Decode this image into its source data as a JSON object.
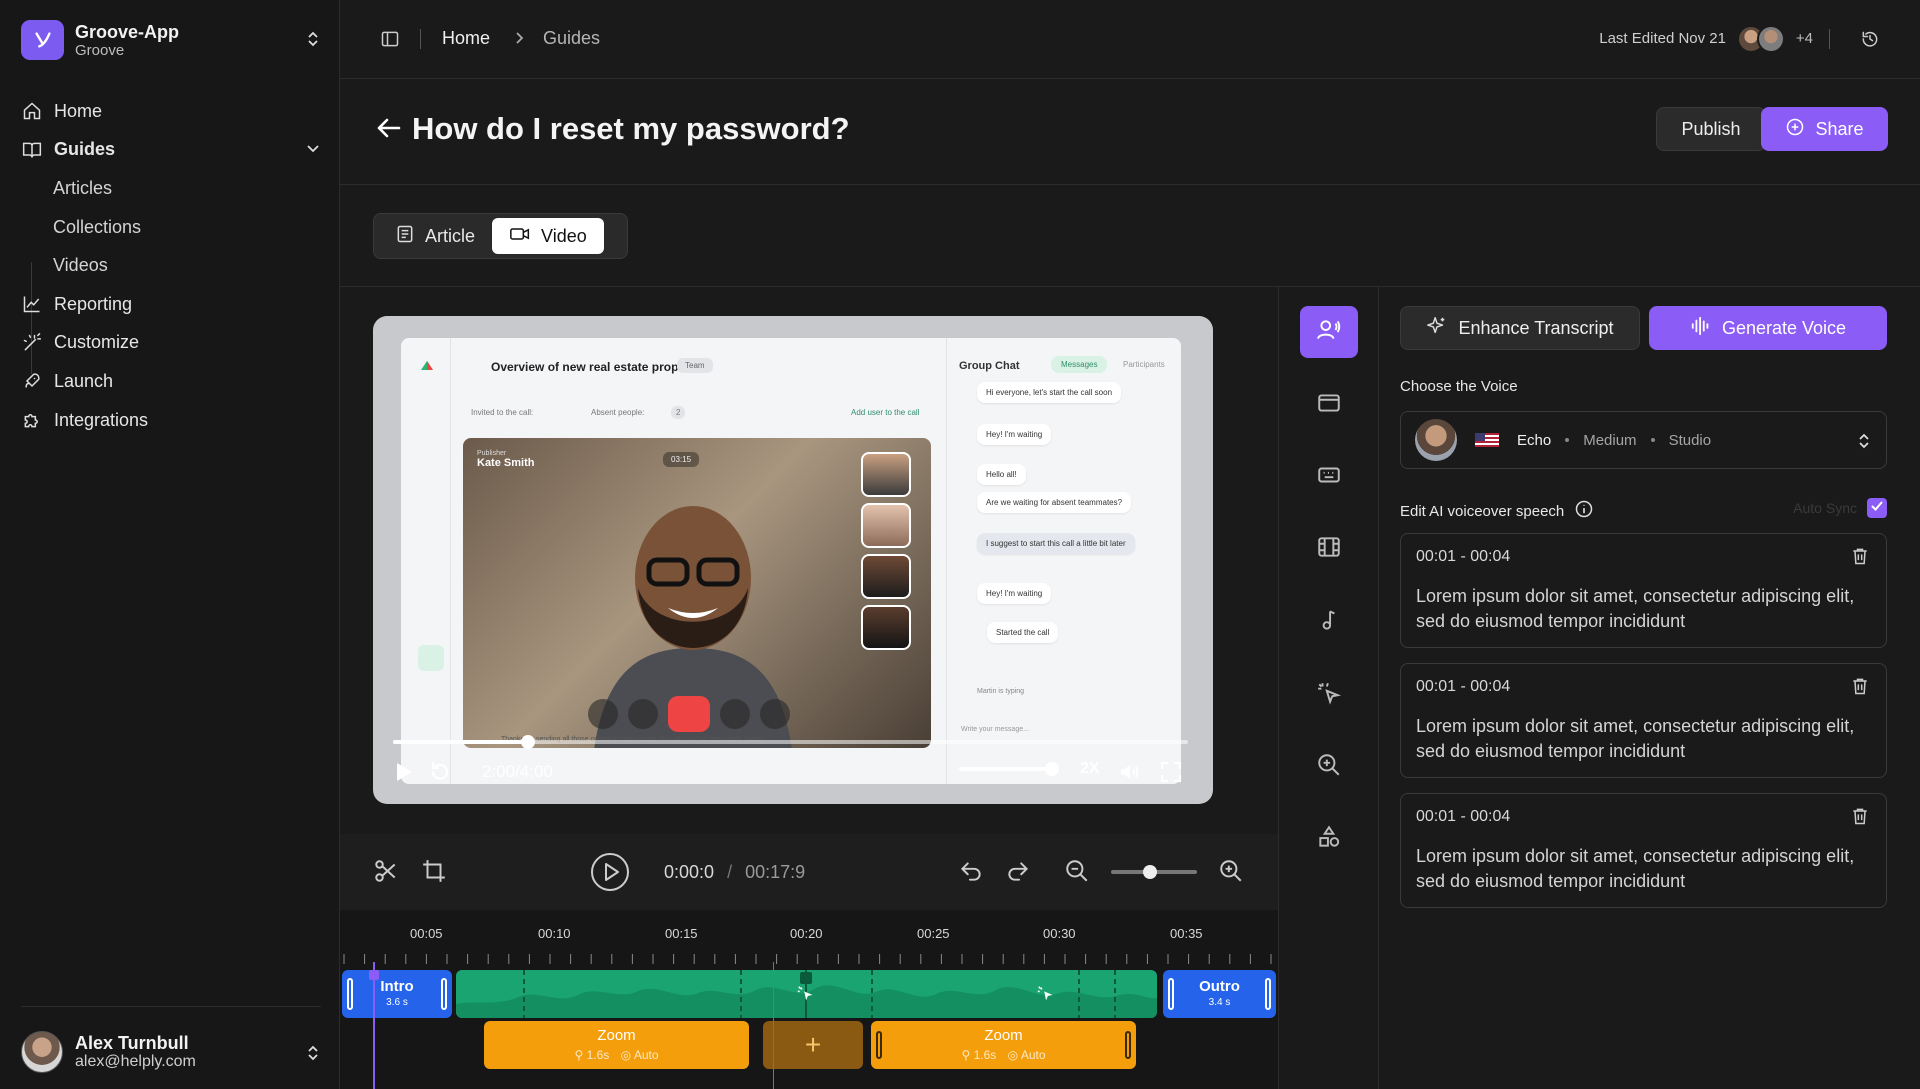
{
  "workspace": {
    "name": "Groove-App",
    "sub": "Groove"
  },
  "nav": [
    {
      "label": "Home",
      "icon": "home-icon"
    },
    {
      "label": "Guides",
      "icon": "book-icon"
    },
    {
      "label": "Articles"
    },
    {
      "label": "Collections"
    },
    {
      "label": "Videos"
    },
    {
      "label": "Reporting",
      "icon": "chart-icon"
    },
    {
      "label": "Customize",
      "icon": "wand-icon"
    },
    {
      "label": "Launch",
      "icon": "rocket-icon"
    },
    {
      "label": "Integrations",
      "icon": "puzzle-icon"
    }
  ],
  "user": {
    "name": "Alex Turnbull",
    "email": "alex@helply.com"
  },
  "breadcrumb": {
    "home": "Home",
    "current": "Guides"
  },
  "topbar": {
    "last_edited": "Last Edited Nov 21",
    "extra_editors": "+4"
  },
  "page": {
    "title": "How do I reset my password?",
    "publish": "Publish",
    "share": "Share"
  },
  "tabs": {
    "article": "Article",
    "video": "Video",
    "active": "Video"
  },
  "video": {
    "meeting_title": "Overview of new real estate proposals",
    "team_badge": "Team",
    "invited": "Invited to the call:",
    "absent": "Absent people:",
    "absent_count": "2",
    "add_user": "Add user to the call",
    "publisher_role": "Publisher",
    "publisher_name": "Kate Smith",
    "call_time": "03:15",
    "chat_title": "Group Chat",
    "chat_tab_messages": "Messages",
    "chat_tab_participants": "Participants",
    "chat_messages": [
      "Hi everyone, let's start the call soon",
      "Hey! I'm waiting",
      "Hello all!",
      "Are we waiting for absent teammates?",
      "I suggest to start this call a little bit later",
      "Hey! I'm waiting",
      "Started the call"
    ],
    "typing": "Martin is typing",
    "message_placeholder": "Write your message...",
    "transcript_snippet": "Thanks for sending all those completed transcripts through - we've been really happy...",
    "timecode": "2:00/4:00",
    "progress": 0.17,
    "volume": 0.95,
    "speed": "2X"
  },
  "editor": {
    "current_time": "0:00:0",
    "separator": "/",
    "total_time": "00:17:9",
    "zoom_level": 0.45
  },
  "timeline": {
    "ticks": [
      "00:05",
      "00:10",
      "00:15",
      "00:20",
      "00:25",
      "00:30",
      "00:35"
    ],
    "intro": {
      "label": "Intro",
      "duration": "3.6 s"
    },
    "outro": {
      "label": "Outro",
      "duration": "3.4 s"
    },
    "zoom_clips": [
      {
        "label": "Zoom",
        "duration": "1.6s",
        "mode": "Auto"
      },
      {
        "label": "Zoom",
        "duration": "1.6s",
        "mode": "Auto"
      }
    ],
    "add_label": "+"
  },
  "voice_panel": {
    "enhance": "Enhance Transcript",
    "generate": "Generate Voice",
    "choose_label": "Choose the Voice",
    "voice": {
      "name": "Echo",
      "pitch": "Medium",
      "style": "Studio"
    },
    "edit_label": "Edit AI voiceover speech",
    "auto_sync": "Auto Sync",
    "auto_sync_checked": true,
    "segments": [
      {
        "time": "00:01 - 00:04",
        "text": "Lorem ipsum dolor sit amet, consectetur adipiscing elit, sed do eiusmod tempor incididunt"
      },
      {
        "time": "00:01 - 00:04",
        "text": "Lorem ipsum dolor sit amet, consectetur adipiscing elit, sed do eiusmod tempor incididunt"
      },
      {
        "time": "00:01 - 00:04",
        "text": "Lorem ipsum dolor sit amet, consectetur adipiscing elit, sed do eiusmod tempor incididunt"
      }
    ]
  },
  "colors": {
    "accent": "#8b5cf6",
    "intro_clip": "#2563eb",
    "audio_clip": "#1aa472",
    "zoom_clip": "#f59e0b"
  }
}
